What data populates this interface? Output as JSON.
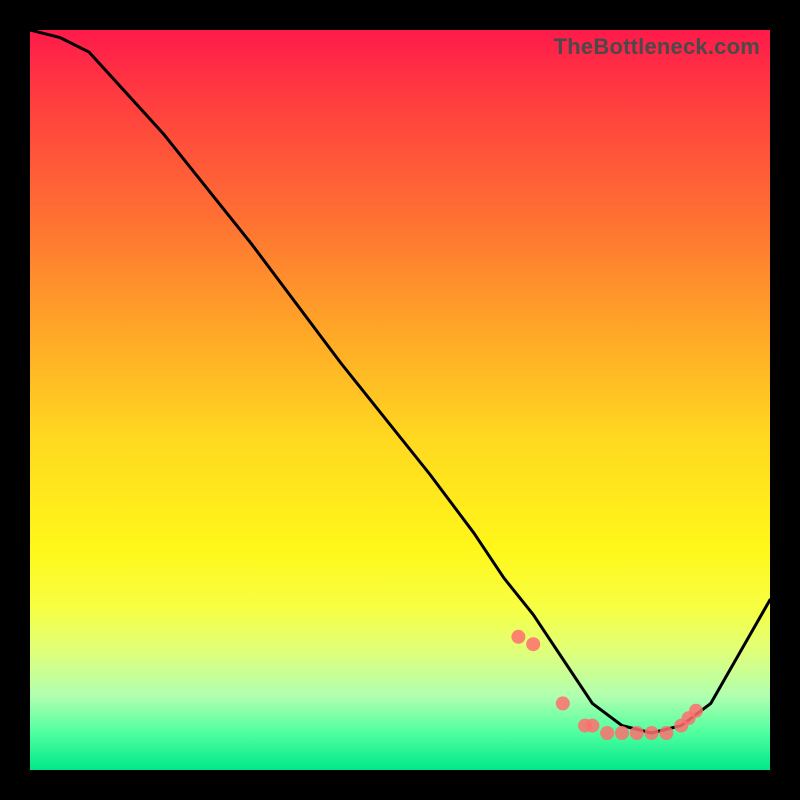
{
  "watermark": "TheBottleneck.com",
  "chart_data": {
    "type": "line",
    "title": "",
    "xlabel": "",
    "ylabel": "",
    "xlim": [
      0,
      100
    ],
    "ylim": [
      0,
      100
    ],
    "series": [
      {
        "name": "bottleneck-curve",
        "x": [
          0,
          4,
          8,
          18,
          30,
          42,
          54,
          60,
          64,
          68,
          72,
          76,
          80,
          84,
          88,
          92,
          100
        ],
        "values": [
          100,
          99,
          97,
          86,
          71,
          55,
          40,
          32,
          26,
          21,
          15,
          9,
          6,
          5,
          6,
          9,
          23
        ]
      }
    ],
    "markers": {
      "name": "highlighted-points",
      "color": "#ff6f6f",
      "x": [
        66,
        68,
        72,
        75,
        76,
        78,
        80,
        82,
        84,
        86,
        88,
        89,
        90
      ],
      "values": [
        18,
        17,
        9,
        6,
        6,
        5,
        5,
        5,
        5,
        5,
        6,
        7,
        8
      ]
    },
    "colors": {
      "curve": "#000000",
      "marker": "#ff6f6f",
      "gradient_top": "#ff1a4a",
      "gradient_mid": "#fff71a",
      "gradient_bottom": "#00e88a"
    }
  }
}
